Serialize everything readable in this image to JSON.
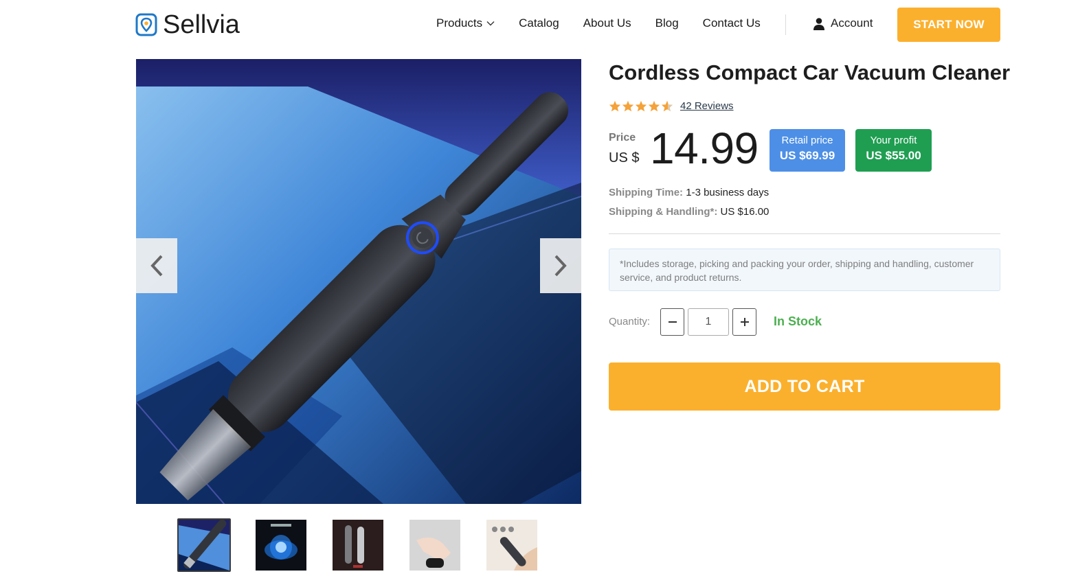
{
  "header": {
    "brand": "Sellvia",
    "nav": [
      {
        "label": "Products",
        "has_dropdown": true
      },
      {
        "label": "Catalog"
      },
      {
        "label": "About Us"
      },
      {
        "label": "Blog"
      },
      {
        "label": "Contact Us"
      }
    ],
    "account_label": "Account",
    "cta_label": "START NOW"
  },
  "gallery": {
    "prev_icon": "chevron-left-icon",
    "next_icon": "chevron-right-icon",
    "thumbnail_count": 5,
    "active_thumbnail": 0
  },
  "product": {
    "title": "Cordless Compact Car Vacuum Cleaner",
    "rating": 4.5,
    "reviews_label": "42 Reviews",
    "price_label": "Price",
    "price_currency": "US $",
    "price_value": "14.99",
    "retail_label": "Retail price",
    "retail_value": "US $69.99",
    "profit_label": "Your profit",
    "profit_value": "US $55.00",
    "shipping_time_label": "Shipping Time:",
    "shipping_time_value": "1-3 business days",
    "shipping_handling_label": "Shipping & Handling*:",
    "shipping_handling_value": "US $16.00",
    "note": "*Includes storage, picking and packing your order, shipping and handling, customer service, and product returns.",
    "quantity_label": "Quantity:",
    "quantity_value": "1",
    "stock_label": "In Stock",
    "add_to_cart_label": "ADD TO CART"
  },
  "colors": {
    "accent": "#fbb02d",
    "retail_badge": "#4d8fe6",
    "profit_badge": "#1f9e52",
    "in_stock": "#4caf50",
    "logo_blue": "#1e78c8"
  }
}
